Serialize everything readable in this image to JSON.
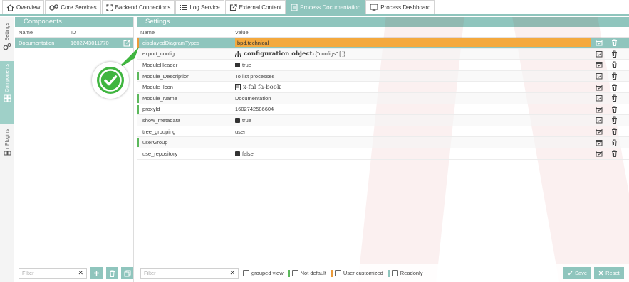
{
  "tabs": [
    {
      "label": "Overview",
      "icon": "home-icon",
      "active": false
    },
    {
      "label": "Core Services",
      "icon": "gears-icon",
      "active": false
    },
    {
      "label": "Backend Connections",
      "icon": "expand-icon",
      "active": false
    },
    {
      "label": "Log Service",
      "icon": "list-icon",
      "active": false
    },
    {
      "label": "External Content",
      "icon": "external-link-icon",
      "active": false
    },
    {
      "label": "Process Documentation",
      "icon": "document-icon",
      "active": true
    },
    {
      "label": "Process Dashboard",
      "icon": "monitor-icon",
      "active": false
    }
  ],
  "vertical_tabs": [
    {
      "label": "Settings",
      "icon": "gears-icon",
      "selected": false
    },
    {
      "label": "Components",
      "icon": "components-icon",
      "selected": true
    },
    {
      "label": "Plugins",
      "icon": "plugins-icon",
      "selected": false
    }
  ],
  "components": {
    "title": "Components",
    "col_name": "Name",
    "col_id": "ID",
    "rows": [
      {
        "name": "Documentation",
        "id": "1602743011770"
      }
    ],
    "filter_placeholder": "Filter",
    "filter_clear": "✕"
  },
  "settings": {
    "title": "Settings",
    "col_name": "Name",
    "col_value": "Value",
    "rows": [
      {
        "name": "displayedDiagramTypes",
        "value": "bpd.technical",
        "marker": "#ea9a3a",
        "highlight": true
      },
      {
        "name": "export_config",
        "value": "configuration object:",
        "extra": "{\"configs\":[ ]}",
        "icon": "sitemap-icon",
        "bold": true,
        "marker": ""
      },
      {
        "name": "ModuleHeader",
        "value": "true",
        "checkbox": true,
        "marker": ""
      },
      {
        "name": "Module_Description",
        "value": "To list processes",
        "marker": "#5cb85c"
      },
      {
        "name": "Module_Icon",
        "value": "x-fal fa-book",
        "icon": "book-icon",
        "serif": true,
        "marker": ""
      },
      {
        "name": "Module_Name",
        "value": "Documentation",
        "marker": "#5cb85c"
      },
      {
        "name": "proxyId",
        "value": "1602742586604",
        "marker": "#5cb85c"
      },
      {
        "name": "show_metadata",
        "value": "true",
        "checkbox": true,
        "marker": ""
      },
      {
        "name": "tree_grouping",
        "value": "user",
        "marker": ""
      },
      {
        "name": "userGroup",
        "value": "",
        "marker": "#5cb85c"
      },
      {
        "name": "use_repository",
        "value": "false",
        "checkbox": true,
        "marker": ""
      }
    ],
    "filter_placeholder": "Filter",
    "filter_clear": "✕",
    "legend": {
      "grouped_view": "grouped view",
      "not_default": "Not default",
      "user_customized": "User customized",
      "readonly": "Readonly"
    },
    "save_label": "Save",
    "reset_label": "Reset"
  },
  "colors": {
    "accent": "#8fc5bd",
    "not_default": "#5cb85c",
    "user_customized": "#ea9a3a",
    "readonly": "#8fc5bd",
    "highlight_row": "#f4a93e",
    "success": "#3fb53f"
  }
}
